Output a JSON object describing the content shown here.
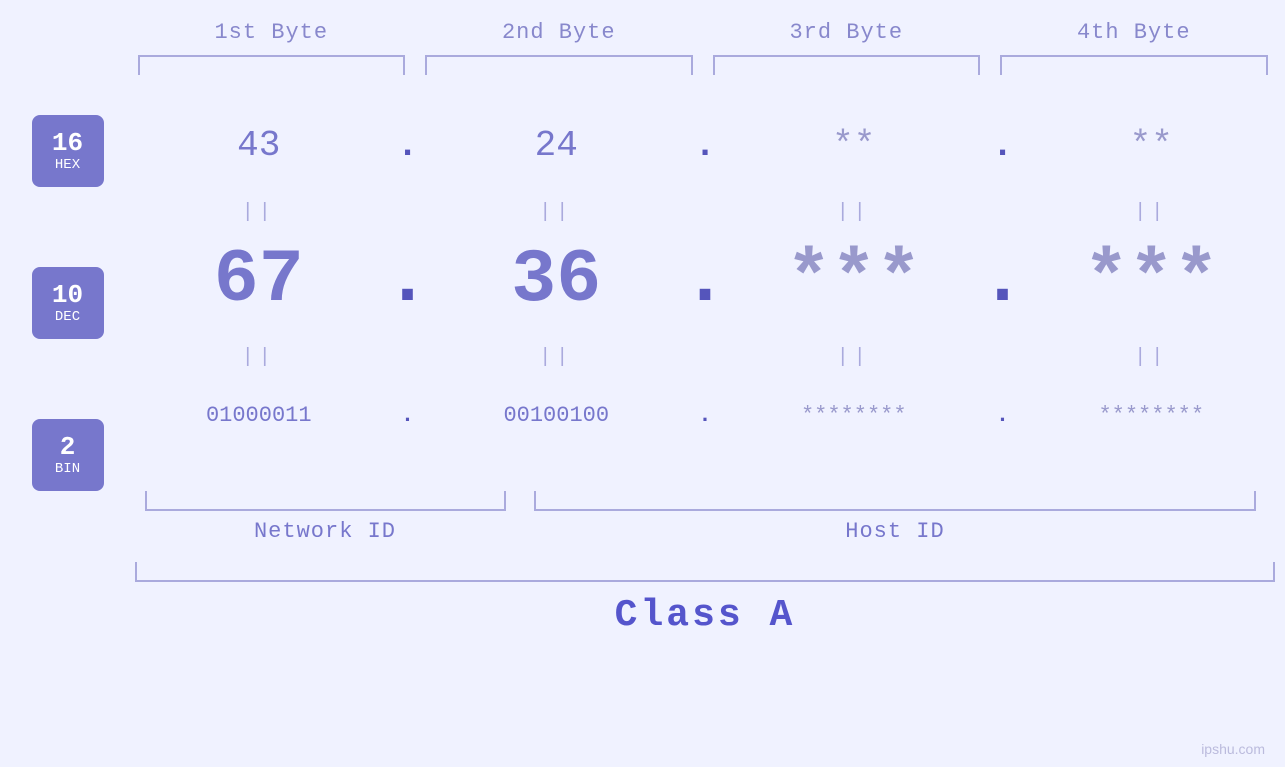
{
  "header": {
    "byte1": "1st Byte",
    "byte2": "2nd Byte",
    "byte3": "3rd Byte",
    "byte4": "4th Byte"
  },
  "badges": {
    "hex": {
      "number": "16",
      "label": "HEX"
    },
    "dec": {
      "number": "10",
      "label": "DEC"
    },
    "bin": {
      "number": "2",
      "label": "BIN"
    }
  },
  "hex_row": {
    "b1": "43",
    "dot1": ".",
    "b2": "24",
    "dot2": ".",
    "b3": "**",
    "dot3": ".",
    "b4": "**"
  },
  "dec_row": {
    "b1": "67",
    "dot1": ".",
    "b2": "36",
    "dot2": ".",
    "b3": "***",
    "dot3": ".",
    "b4": "***"
  },
  "bin_row": {
    "b1": "01000011",
    "dot1": ".",
    "b2": "00100100",
    "dot2": ".",
    "b3": "********",
    "dot3": ".",
    "b4": "********"
  },
  "separator": "||",
  "labels": {
    "network_id": "Network ID",
    "host_id": "Host ID",
    "class": "Class A"
  },
  "watermark": "ipshu.com"
}
